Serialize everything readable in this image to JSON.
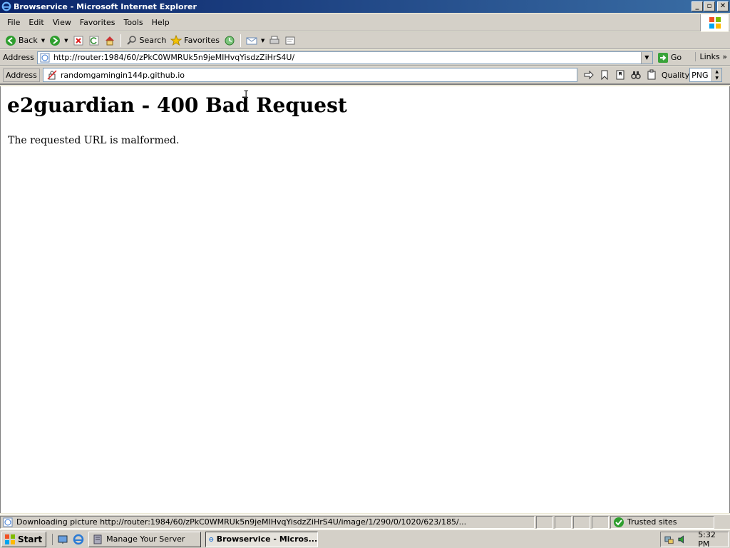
{
  "window": {
    "title": "Browservice - Microsoft Internet Explorer",
    "buttons": {
      "minimize": "_",
      "maximize": "▫",
      "close": "✕"
    }
  },
  "menubar": {
    "items": [
      {
        "label": "File"
      },
      {
        "label": "Edit"
      },
      {
        "label": "View"
      },
      {
        "label": "Favorites"
      },
      {
        "label": "Tools"
      },
      {
        "label": "Help"
      }
    ]
  },
  "toolbar": {
    "back_label": "Back",
    "search_label": "Search",
    "favorites_label": "Favorites"
  },
  "address_bar": {
    "label": "Address",
    "url": "http://router:1984/60/zPkC0WMRUk5n9jeMIHvqYisdzZiHrS4U/",
    "go_label": "Go",
    "links_label": "Links"
  },
  "browservice_bar": {
    "label": "Address",
    "url": "randomgamingin144p.github.io",
    "quality_label": "Quality",
    "quality_value": "PNG"
  },
  "page": {
    "heading": "e2guardian - 400 Bad Request",
    "message": "The requested URL is malformed."
  },
  "statusbar": {
    "text": "Downloading picture http://router:1984/60/zPkC0WMRUk5n9jeMIHvqYisdzZiHrS4U/image/1/290/0/1020/623/185/...",
    "zone": "Trusted sites"
  },
  "taskbar": {
    "start_label": "Start",
    "tasks": [
      {
        "label": "Manage Your Server",
        "active": false
      },
      {
        "label": "Browservice - Micros...",
        "active": true
      }
    ],
    "clock": "5:32 PM"
  },
  "colors": {
    "titlebar_start": "#0a246a",
    "titlebar_end": "#3a6ea5",
    "chrome": "#d4d0c8",
    "content_bg": "#ffffff"
  }
}
